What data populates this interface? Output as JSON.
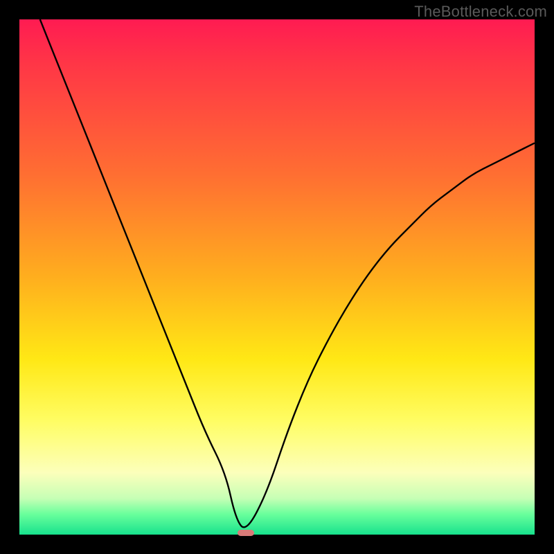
{
  "watermark": "TheBottleneck.com",
  "chart_data": {
    "type": "line",
    "title": "",
    "xlabel": "",
    "ylabel": "",
    "xlim": [
      0,
      100
    ],
    "ylim": [
      0,
      100
    ],
    "grid": false,
    "series": [
      {
        "name": "curve",
        "x": [
          4,
          8,
          12,
          16,
          20,
          24,
          28,
          32,
          36,
          40,
          42,
          44,
          48,
          52,
          56,
          60,
          64,
          68,
          72,
          76,
          80,
          84,
          88,
          92,
          96,
          100
        ],
        "values": [
          100,
          90,
          80,
          70,
          60,
          50,
          40,
          30,
          20,
          12,
          3,
          0.5,
          8,
          20,
          30,
          38,
          45,
          51,
          56,
          60,
          64,
          67,
          70,
          72,
          74,
          76
        ]
      }
    ],
    "marker": {
      "x": 44,
      "y": 0.3,
      "color": "#d87a78",
      "width_pct": 3.2,
      "height_pct": 1.2
    }
  },
  "colors": {
    "curve_stroke": "#000000",
    "marker": "#d87a78",
    "frame": "#000000"
  }
}
